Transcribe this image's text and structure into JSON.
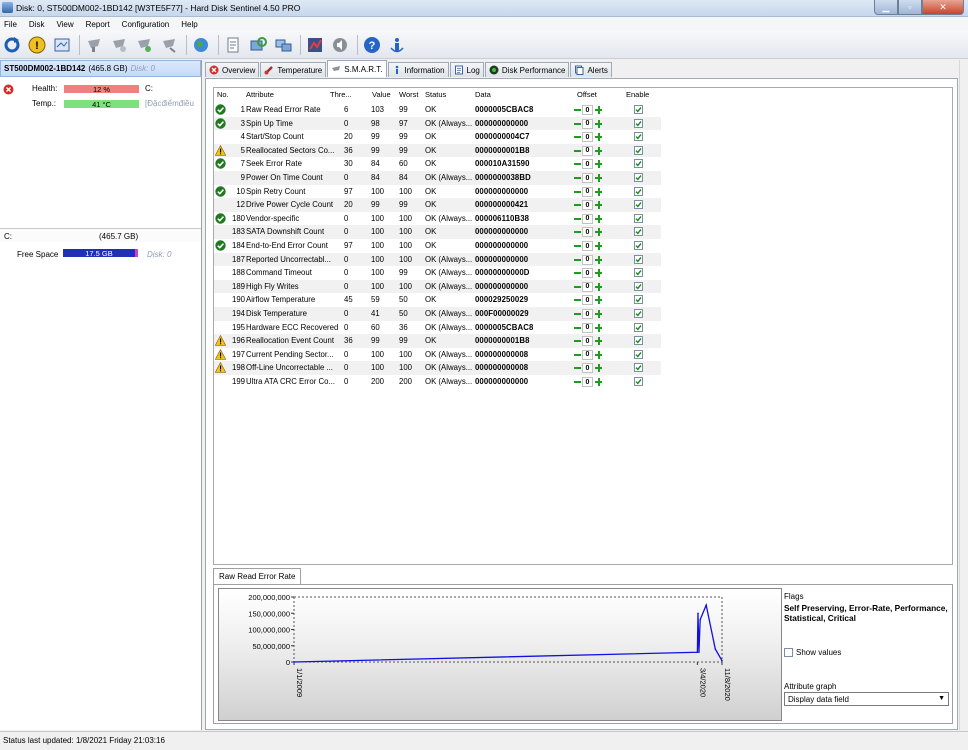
{
  "window": {
    "title": "Disk: 0, ST500DM002-1BD142 [W3TE5F77]  -  Hard Disk Sentinel 4.50 PRO"
  },
  "menu": [
    "File",
    "Disk",
    "View",
    "Report",
    "Configuration",
    "Help"
  ],
  "toolbar": [
    "refresh-icon",
    "warning-icon",
    "report-icon",
    "disk-icon",
    "disk-icon",
    "disk-icon",
    "disk-icon",
    "globe-icon",
    "document-icon",
    "refresh-disk-icon",
    "network-icon",
    "chart-icon",
    "sound-icon",
    "help-icon",
    "info-icon"
  ],
  "left": {
    "disk_name": "ST500DM002-1BD142",
    "disk_size": "(465.8 GB)",
    "disk_id": "Disk: 0",
    "health_label": "Health:",
    "health_value": "12 %",
    "health_drive": "C:",
    "temp_label": "Temp.:",
    "temp_value": "41 °C",
    "temp_extra": "[Đặcđiểmđiều",
    "volume_letter": "C:",
    "volume_size": "(465.7 GB)",
    "free_label": "Free Space",
    "free_value": "17.5 GB",
    "free_disk": "Disk: 0",
    "health_color": "#f08080",
    "temp_color": "#7ee07e",
    "free_color": "#1f2fb8"
  },
  "tabs": [
    {
      "label": "Overview",
      "icon": "error-icon"
    },
    {
      "label": "Temperature",
      "icon": "thermometer-icon"
    },
    {
      "label": "S.M.A.R.T.",
      "icon": "smart-icon"
    },
    {
      "label": "Information",
      "icon": "info-icon"
    },
    {
      "label": "Log",
      "icon": "log-icon"
    },
    {
      "label": "Disk Performance",
      "icon": "performance-icon"
    },
    {
      "label": "Alerts",
      "icon": "alerts-icon"
    }
  ],
  "columns": [
    "No.",
    "Attribute",
    "Thre...",
    "Value",
    "Worst",
    "Status",
    "Data",
    "Offset",
    "Enable"
  ],
  "rows": [
    {
      "icon": "ok",
      "no": "1",
      "attr": "Raw Read Error Rate",
      "thr": "6",
      "val": "103",
      "worst": "99",
      "status": "OK",
      "data": "0000005CBAC8",
      "off": "0"
    },
    {
      "icon": "ok",
      "no": "3",
      "attr": "Spin Up Time",
      "thr": "0",
      "val": "98",
      "worst": "97",
      "status": "OK (Always...",
      "data": "000000000000",
      "off": "0"
    },
    {
      "icon": "",
      "no": "4",
      "attr": "Start/Stop Count",
      "thr": "20",
      "val": "99",
      "worst": "99",
      "status": "OK",
      "data": "0000000004C7",
      "off": "0"
    },
    {
      "icon": "warn",
      "no": "5",
      "attr": "Reallocated Sectors Co...",
      "thr": "36",
      "val": "99",
      "worst": "99",
      "status": "OK",
      "data": "0000000001B8",
      "off": "0"
    },
    {
      "icon": "ok",
      "no": "7",
      "attr": "Seek Error Rate",
      "thr": "30",
      "val": "84",
      "worst": "60",
      "status": "OK",
      "data": "000010A31590",
      "off": "0"
    },
    {
      "icon": "",
      "no": "9",
      "attr": "Power On Time Count",
      "thr": "0",
      "val": "84",
      "worst": "84",
      "status": "OK (Always...",
      "data": "0000000038BD",
      "off": "0"
    },
    {
      "icon": "ok",
      "no": "10",
      "attr": "Spin Retry Count",
      "thr": "97",
      "val": "100",
      "worst": "100",
      "status": "OK",
      "data": "000000000000",
      "off": "0"
    },
    {
      "icon": "",
      "no": "12",
      "attr": "Drive Power Cycle Count",
      "thr": "20",
      "val": "99",
      "worst": "99",
      "status": "OK",
      "data": "000000000421",
      "off": "0"
    },
    {
      "icon": "ok",
      "no": "180",
      "attr": "Vendor-specific",
      "thr": "0",
      "val": "100",
      "worst": "100",
      "status": "OK (Always...",
      "data": "000006110B38",
      "off": "0"
    },
    {
      "icon": "",
      "no": "183",
      "attr": "SATA Downshift Count",
      "thr": "0",
      "val": "100",
      "worst": "100",
      "status": "OK",
      "data": "000000000000",
      "off": "0"
    },
    {
      "icon": "ok",
      "no": "184",
      "attr": "End-to-End Error Count",
      "thr": "97",
      "val": "100",
      "worst": "100",
      "status": "OK",
      "data": "000000000000",
      "off": "0"
    },
    {
      "icon": "",
      "no": "187",
      "attr": "Reported Uncorrectabl...",
      "thr": "0",
      "val": "100",
      "worst": "100",
      "status": "OK (Always...",
      "data": "000000000000",
      "off": "0"
    },
    {
      "icon": "",
      "no": "188",
      "attr": "Command Timeout",
      "thr": "0",
      "val": "100",
      "worst": "99",
      "status": "OK (Always...",
      "data": "00000000000D",
      "off": "0"
    },
    {
      "icon": "",
      "no": "189",
      "attr": "High Fly Writes",
      "thr": "0",
      "val": "100",
      "worst": "100",
      "status": "OK (Always...",
      "data": "000000000000",
      "off": "0"
    },
    {
      "icon": "",
      "no": "190",
      "attr": "Airflow Temperature",
      "thr": "45",
      "val": "59",
      "worst": "50",
      "status": "OK",
      "data": "000029250029",
      "off": "0"
    },
    {
      "icon": "",
      "no": "194",
      "attr": "Disk Temperature",
      "thr": "0",
      "val": "41",
      "worst": "50",
      "status": "OK (Always...",
      "data": "000F00000029",
      "off": "0"
    },
    {
      "icon": "",
      "no": "195",
      "attr": "Hardware ECC Recovered",
      "thr": "0",
      "val": "60",
      "worst": "36",
      "status": "OK (Always...",
      "data": "0000005CBAC8",
      "off": "0"
    },
    {
      "icon": "warn",
      "no": "196",
      "attr": "Reallocation Event Count",
      "thr": "36",
      "val": "99",
      "worst": "99",
      "status": "OK",
      "data": "0000000001B8",
      "off": "0"
    },
    {
      "icon": "warn",
      "no": "197",
      "attr": "Current Pending Sector...",
      "thr": "0",
      "val": "100",
      "worst": "100",
      "status": "OK (Always...",
      "data": "000000000008",
      "off": "0"
    },
    {
      "icon": "warn",
      "no": "198",
      "attr": "Off-Line Uncorrectable ...",
      "thr": "0",
      "val": "100",
      "worst": "100",
      "status": "OK (Always...",
      "data": "000000000008",
      "off": "0"
    },
    {
      "icon": "",
      "no": "199",
      "attr": "Ultra ATA CRC Error Co...",
      "thr": "0",
      "val": "200",
      "worst": "200",
      "status": "OK (Always...",
      "data": "000000000000",
      "off": "0"
    }
  ],
  "graph": {
    "tab_label": "Raw Read Error Rate",
    "flags_title": "Flags",
    "flags_value": "Self Preserving, Error-Rate, Performance, Statistical, Critical",
    "show_values_label": "Show values",
    "attribute_graph_label": "Attribute graph",
    "attribute_graph_value": "Display data field"
  },
  "chart_data": {
    "type": "line",
    "y_ticks": [
      "200,000,000",
      "150,000,000",
      "100,000,000",
      "50,000,000",
      "0"
    ],
    "x_ticks": [
      "1/1/2009",
      "3/4/2020",
      "11/8/2020"
    ],
    "ylim": [
      0,
      200000000
    ],
    "color": "#1010e0",
    "points": [
      {
        "x": "1/1/2009",
        "y": 0
      },
      {
        "x": "3/4/2020",
        "y": 30000000
      },
      {
        "x": "3/10/2020",
        "y": 150000000
      },
      {
        "x": "3/20/2020",
        "y": 30000000
      },
      {
        "x": "4/1/2020",
        "y": 130000000
      },
      {
        "x": "6/1/2020",
        "y": 175000000
      },
      {
        "x": "9/1/2020",
        "y": 40000000
      },
      {
        "x": "11/8/2020",
        "y": 4000000
      }
    ]
  },
  "statusbar": {
    "text": "Status last updated: 1/8/2021 Friday 21:03:16"
  }
}
